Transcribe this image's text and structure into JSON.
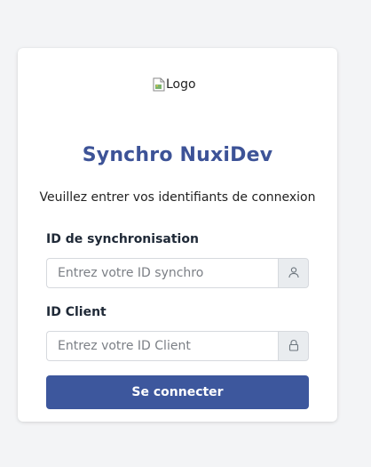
{
  "logo": {
    "alt_text": "Logo"
  },
  "header": {
    "title": "Synchro NuxiDev",
    "subtitle": "Veuillez entrer vos identifiants de connexion"
  },
  "form": {
    "sync_id": {
      "label": "ID de synchronisation",
      "placeholder": "Entrez votre ID synchro",
      "value": "",
      "icon": "user-icon"
    },
    "client_id": {
      "label": "ID Client",
      "placeholder": "Entrez votre ID Client",
      "value": "",
      "icon": "lock-icon"
    },
    "submit_label": "Se connecter"
  },
  "colors": {
    "page_background": "#f3f4f6",
    "title": "#3d5397",
    "button": "#3d579d",
    "addon_background": "#e9ecef"
  }
}
